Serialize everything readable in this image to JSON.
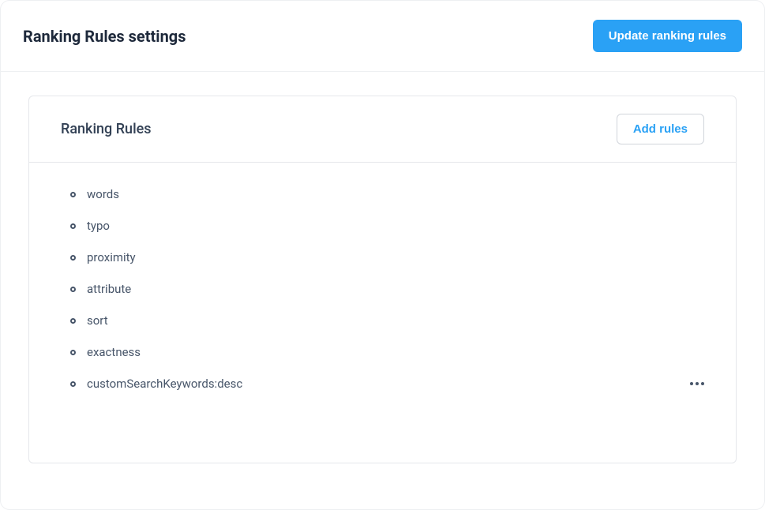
{
  "header": {
    "title": "Ranking Rules settings",
    "update_button": "Update ranking rules"
  },
  "panel": {
    "title": "Ranking Rules",
    "add_button": "Add rules"
  },
  "rules": [
    {
      "label": "words",
      "has_menu": false
    },
    {
      "label": "typo",
      "has_menu": false
    },
    {
      "label": "proximity",
      "has_menu": false
    },
    {
      "label": "attribute",
      "has_menu": false
    },
    {
      "label": "sort",
      "has_menu": false
    },
    {
      "label": "exactness",
      "has_menu": false
    },
    {
      "label": "customSearchKeywords:desc",
      "has_menu": true
    }
  ]
}
